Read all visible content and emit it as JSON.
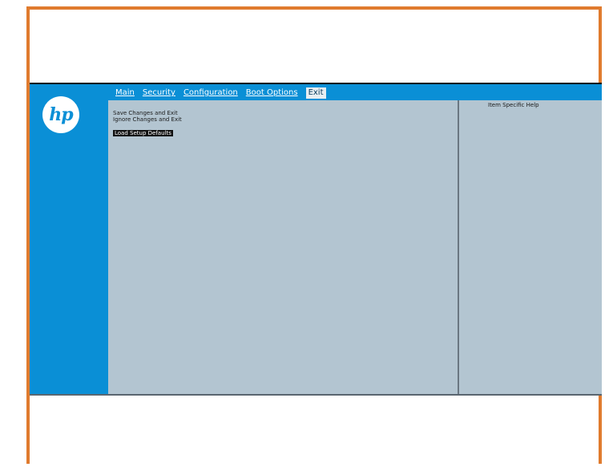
{
  "logo": {
    "text": "hp"
  },
  "menu": {
    "items": [
      {
        "label": "Main"
      },
      {
        "label": "Security"
      },
      {
        "label": "Configuration"
      },
      {
        "label": "Boot Options"
      },
      {
        "label": "Exit"
      }
    ],
    "active": "Exit"
  },
  "exit_menu": {
    "options": [
      {
        "label": "Save Changes and Exit"
      },
      {
        "label": "Ignore Changes and Exit"
      },
      {
        "label": "Load Setup Defaults"
      }
    ],
    "selected": "Load Setup Defaults"
  },
  "help_panel": {
    "title": "Item Specific Help"
  },
  "colors": {
    "frame_border": "#e07b2e",
    "accent_blue": "#0a8fd6",
    "panel_bg": "#b3c5d1"
  }
}
